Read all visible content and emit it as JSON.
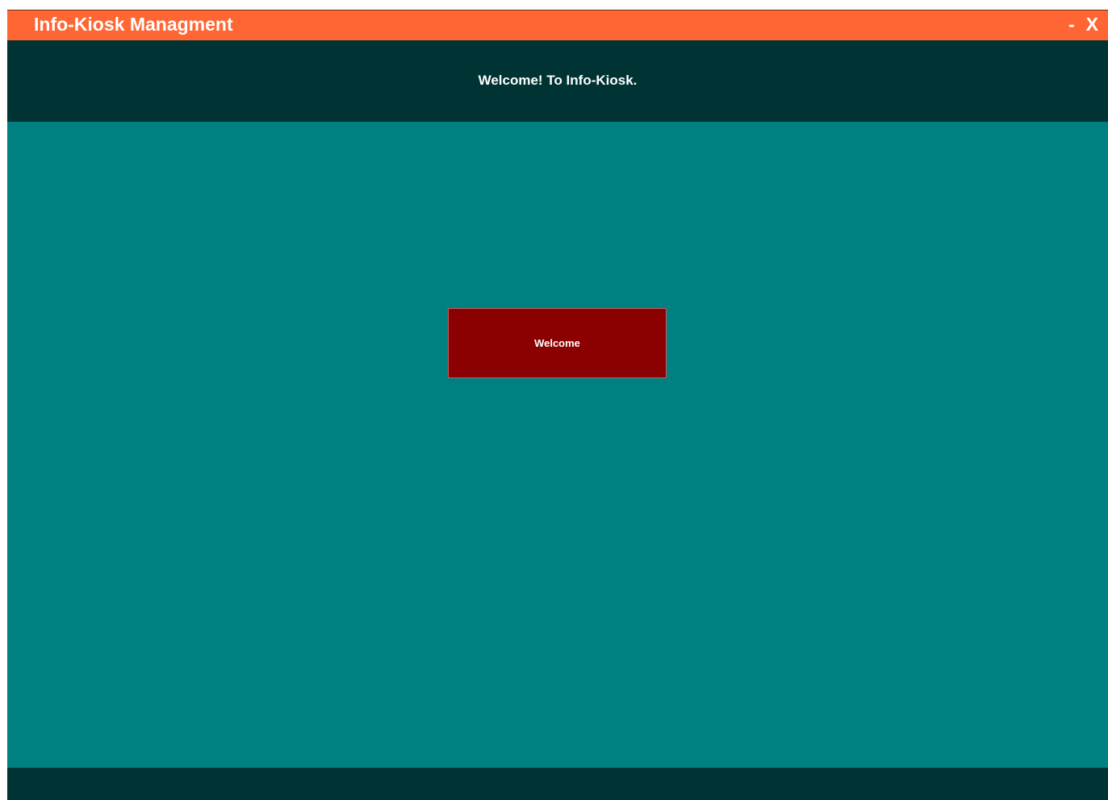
{
  "window": {
    "title": "Info-Kiosk Managment",
    "minimize_label": "-",
    "close_label": "X"
  },
  "header": {
    "welcome_text": "Welcome! To Info-Kiosk."
  },
  "main": {
    "welcome_button_label": "Welcome"
  },
  "colors": {
    "titlebar": "#ff6633",
    "header": "#003333",
    "content": "#008080",
    "button": "#8b0000",
    "footer": "#003333"
  }
}
